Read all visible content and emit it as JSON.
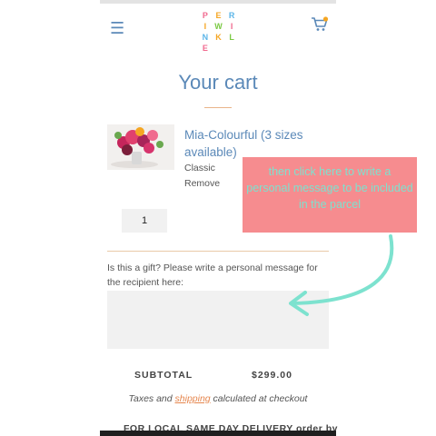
{
  "header": {
    "logo_letters": [
      "P",
      "E",
      "R",
      "I",
      "W",
      "I",
      "N",
      "K",
      "L",
      "E"
    ],
    "logo_colors": [
      "#f06a8f",
      "#f5a623",
      "#5bb5e8",
      "#f5a623",
      "#7ac943",
      "#f06a8f",
      "#5bb5e8",
      "#f5a623",
      "#7ac943",
      "#f06a8f"
    ],
    "menu_icon": "hamburger-icon",
    "cart_icon": "shopping-cart-icon",
    "cart_badge_color": "#f5a623"
  },
  "cart": {
    "title": "Your cart",
    "item": {
      "name": "Mia-Colourful (3 sizes available)",
      "variant": "Classic",
      "remove_label": "Remove",
      "quantity": "1"
    },
    "gift": {
      "label": "Is this a gift? Please write a personal message for the recipient here:",
      "message": ""
    },
    "subtotal_label": "SUBTOTAL",
    "subtotal_value": "$299.00",
    "tax_note_before": "Taxes and ",
    "tax_note_link": "shipping",
    "tax_note_after": " calculated at checkout",
    "delivery_note": "FOR LOCAL SAME DAY DELIVERY order by"
  },
  "annotation": {
    "text": "then click here to write a personal message to be included in the parcel",
    "background": "#f68c8f",
    "text_color": "#7de2cf"
  }
}
